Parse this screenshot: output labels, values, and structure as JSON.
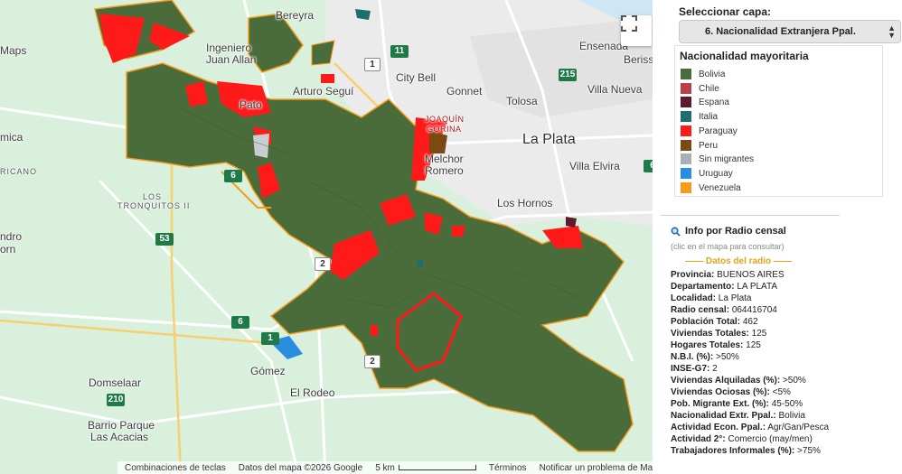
{
  "map": {
    "places": [
      {
        "name": "Bereyra"
      },
      {
        "name": "Ingeniero"
      },
      {
        "name": "Juan Allan"
      },
      {
        "name": "Ensenada"
      },
      {
        "name": "Berisso"
      },
      {
        "name": "City Bell"
      },
      {
        "name": "Gonnet"
      },
      {
        "name": "Tolosa"
      },
      {
        "name": "Villa Nueva"
      },
      {
        "name": "Arturo Seguí"
      },
      {
        "name": "La Plata"
      },
      {
        "name": "Villa Elvira"
      },
      {
        "name": "Los Hornos"
      },
      {
        "name": "Gómez"
      },
      {
        "name": "El Rodeo"
      },
      {
        "name": "Domselaar"
      },
      {
        "name": "Barrio Parque"
      },
      {
        "name": "Las Acacias"
      },
      {
        "name": "Pato"
      },
      {
        "name": "Melchor"
      },
      {
        "name": "Romero"
      },
      {
        "name": "JOAQUÍN"
      },
      {
        "name": "GORINA"
      },
      {
        "name": "LOS"
      },
      {
        "name": "TRONQUITOS II"
      },
      {
        "name": "mica"
      },
      {
        "name": "RICANO"
      },
      {
        "name": "Maps"
      },
      {
        "name": "ndro"
      },
      {
        "name": "orn"
      }
    ],
    "routes": [
      "6",
      "1",
      "2",
      "6",
      "53",
      "210",
      "11",
      "215",
      "6",
      "2",
      "1"
    ],
    "attribution": {
      "shortcuts": "Combinaciones de teclas",
      "data": "Datos del mapa ©2026 Google",
      "scale": "5 km",
      "terms": "Términos",
      "report": "Notificar un problema de Maps"
    }
  },
  "panel": {
    "select_label": "Seleccionar capa:",
    "select_value": "6. Nacionalidad Extranjera Ppal.",
    "legend_title": "Nacionalidad mayoritaria",
    "legend": [
      {
        "label": "Bolivia",
        "color": "#4a6b3a"
      },
      {
        "label": "Chile",
        "color": "#b94048"
      },
      {
        "label": "Espana",
        "color": "#5e1a2e"
      },
      {
        "label": "Italia",
        "color": "#1e6e6e"
      },
      {
        "label": "Paraguay",
        "color": "#ff1a1a"
      },
      {
        "label": "Peru",
        "color": "#7a4a12"
      },
      {
        "label": "Sin migrantes",
        "color": "#a8b0b6"
      },
      {
        "label": "Uruguay",
        "color": "#2a8ee0"
      },
      {
        "label": "Venezuela",
        "color": "#f59a1a"
      }
    ],
    "info_title": "Info por Radio censal",
    "info_sub": "(clic en el mapa para consultar)",
    "datos_title": "—— Datos del radio ——",
    "rows": [
      {
        "k": "Provincia:",
        "v": "BUENOS AIRES"
      },
      {
        "k": "Departamento:",
        "v": "LA PLATA"
      },
      {
        "k": "Localidad:",
        "v": "La Plata"
      },
      {
        "k": "Radio censal:",
        "v": "064416704"
      },
      {
        "k": "Población Total:",
        "v": "462"
      },
      {
        "k": "Viviendas Totales:",
        "v": "125"
      },
      {
        "k": "Hogares Totales:",
        "v": "125"
      },
      {
        "k": "N.B.I. (%):",
        "v": ">50%"
      },
      {
        "k": "INSE-G7:",
        "v": "2"
      },
      {
        "k": "Viviendas Alquiladas (%):",
        "v": ">50%"
      },
      {
        "k": "Viviendas Ociosas (%):",
        "v": "<5%"
      },
      {
        "k": "Pob. Migrante Ext. (%):",
        "v": "45-50%"
      },
      {
        "k": "Nacionalidad Extr. Ppal.:",
        "v": "Bolivia"
      },
      {
        "k": "Actividad Econ. Ppal.:",
        "v": "Agr/Gan/Pesca"
      },
      {
        "k": "Actividad 2°:",
        "v": "Comercio (may/men)"
      },
      {
        "k": "Trabajadores Informales (%):",
        "v": ">75%"
      }
    ],
    "colors": {
      "accent": "#e8a020"
    }
  }
}
